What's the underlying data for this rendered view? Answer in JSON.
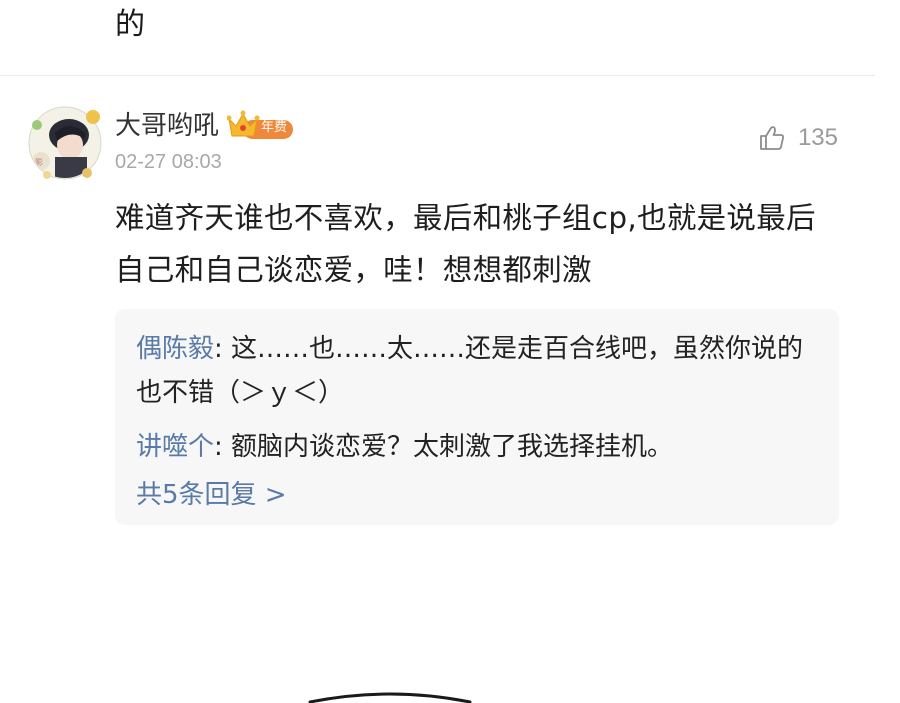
{
  "previous_comment": {
    "tail_text": "的"
  },
  "comment": {
    "username": "大哥哟吼",
    "vip_badge_label": "年费",
    "timestamp": "02-27 08:03",
    "likes": "135",
    "text": "难道齐天谁也不喜欢，最后和桃子组cp,也就是说最后自己和自己谈恋爱，哇！想想都刺激"
  },
  "replies": [
    {
      "author": "偶陈毅",
      "separator": ": ",
      "text": "这……也……太……还是走百合线吧，虽然你说的也不错（＞ｙ＜）"
    },
    {
      "author": "讲噬个",
      "separator": ": ",
      "text": "额脑内谈恋爱？太刺激了我选择挂机。"
    }
  ],
  "more_replies_label": "共5条回复 >",
  "colors": {
    "link_blue": "#5a7aa8",
    "badge_orange": "#f0883a",
    "crown_gold": "#f5b82e",
    "timestamp_gray": "#a8a8a8"
  }
}
